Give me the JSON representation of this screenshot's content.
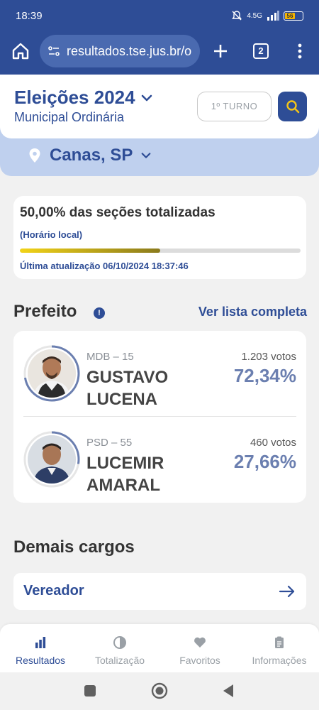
{
  "status": {
    "time": "18:39",
    "network": "4.5G",
    "battery": "56"
  },
  "browser": {
    "url": "resultados.tse.jus.br/o",
    "tab_count": "2"
  },
  "header": {
    "title": "Eleições 2024",
    "subtitle": "Municipal Ordinária",
    "turno_label": "1º TURNO",
    "location": "Canas, SP"
  },
  "progress": {
    "title": "50,00% das seções totalizadas",
    "local_time": "(Horário local)",
    "fraction": 0.5,
    "last_update": "Última atualização 06/10/2024 18:37:46"
  },
  "prefeito": {
    "title": "Prefeito",
    "info_icon": "!",
    "view_all": "Ver lista completa",
    "candidates": [
      {
        "party": "MDB – 15",
        "name_line1": "GUSTAVO",
        "name_line2": "LUCENA",
        "votes": "1.203 votos",
        "percent": "72,34%",
        "share": 0.7234
      },
      {
        "party": "PSD – 55",
        "name_line1": "LUCEMIR",
        "name_line2": "AMARAL",
        "votes": "460 votos",
        "percent": "27,66%",
        "share": 0.2766
      }
    ]
  },
  "demais": {
    "title": "Demais cargos",
    "items": [
      {
        "label": "Vereador"
      }
    ]
  },
  "nav": {
    "items": [
      {
        "label": "Resultados",
        "icon": "bar-chart-icon",
        "active": true
      },
      {
        "label": "Totalização",
        "icon": "pie-icon",
        "active": false
      },
      {
        "label": "Favoritos",
        "icon": "heart-icon",
        "active": false
      },
      {
        "label": "Informações",
        "icon": "clipboard-icon",
        "active": false
      }
    ]
  },
  "colors": {
    "primary": "#2e4d96",
    "accent_bar": "#f2d318",
    "percent": "#6b7fb0"
  }
}
